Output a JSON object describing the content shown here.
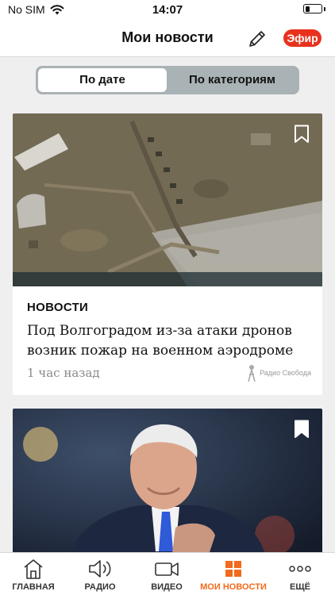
{
  "status_bar": {
    "carrier": "No SIM",
    "time": "14:07"
  },
  "header": {
    "title": "Мои новости",
    "live_label": "Эфир"
  },
  "segment": {
    "by_date": "По дате",
    "by_category": "По категориям"
  },
  "articles": [
    {
      "category": "НОВОСТИ",
      "headline": "Под Волгоградом из-за атаки дронов возник пожар на военном аэродроме",
      "time": "1 час назад",
      "source": "Радио Свобода",
      "bookmarked": false
    },
    {
      "bookmarked": true
    }
  ],
  "tabs": [
    {
      "label": "ГЛАВНАЯ",
      "icon": "home-icon"
    },
    {
      "label": "РАДИО",
      "icon": "speaker-icon"
    },
    {
      "label": "ВИДЕО",
      "icon": "video-camera-icon"
    },
    {
      "label": "МОИ НОВОСТИ",
      "icon": "grid-icon",
      "active": true
    },
    {
      "label": "ЕЩЁ",
      "icon": "more-dots-icon"
    }
  ],
  "colors": {
    "accent": "#f26a1b",
    "live": "#e8321e",
    "segment_bg": "#a9b2b5"
  }
}
